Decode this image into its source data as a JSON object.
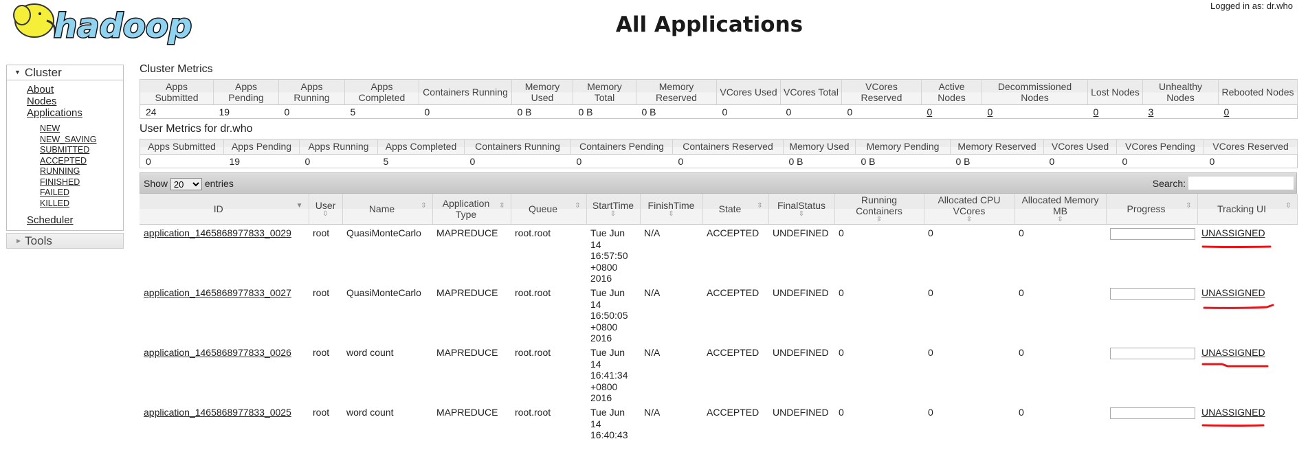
{
  "header": {
    "logo_text": "hadoop",
    "title": "All Applications",
    "logged_in": "Logged in as: dr.who"
  },
  "sidebar": {
    "cluster_label": "Cluster",
    "links": [
      "About",
      "Nodes",
      "Applications"
    ],
    "states": [
      "NEW",
      "NEW_SAVING",
      "SUBMITTED",
      "ACCEPTED",
      "RUNNING",
      "FINISHED",
      "FAILED",
      "KILLED"
    ],
    "scheduler": "Scheduler",
    "tools_label": "Tools"
  },
  "cluster_metrics": {
    "title": "Cluster Metrics",
    "headers": [
      "Apps Submitted",
      "Apps Pending",
      "Apps Running",
      "Apps Completed",
      "Containers Running",
      "Memory Used",
      "Memory Total",
      "Memory Reserved",
      "VCores Used",
      "VCores Total",
      "VCores Reserved",
      "Active Nodes",
      "Decommissioned Nodes",
      "Lost Nodes",
      "Unhealthy Nodes",
      "Rebooted Nodes"
    ],
    "values": [
      "24",
      "19",
      "0",
      "5",
      "0",
      "0 B",
      "0 B",
      "0 B",
      "0",
      "0",
      "0",
      "0",
      "0",
      "0",
      "3",
      "0"
    ],
    "linked": [
      false,
      false,
      false,
      false,
      false,
      false,
      false,
      false,
      false,
      false,
      false,
      true,
      true,
      true,
      true,
      true
    ]
  },
  "user_metrics": {
    "title": "User Metrics for dr.who",
    "headers": [
      "Apps Submitted",
      "Apps Pending",
      "Apps Running",
      "Apps Completed",
      "Containers Running",
      "Containers Pending",
      "Containers Reserved",
      "Memory Used",
      "Memory Pending",
      "Memory Reserved",
      "VCores Used",
      "VCores Pending",
      "VCores Reserved"
    ],
    "values": [
      "0",
      "19",
      "0",
      "5",
      "0",
      "0",
      "0",
      "0 B",
      "0 B",
      "0 B",
      "0",
      "0",
      "0"
    ]
  },
  "table_controls": {
    "show_label": "Show",
    "page_size": "20",
    "entries_label": "entries",
    "search_label": "Search:",
    "search_value": ""
  },
  "apps_table": {
    "headers": [
      "ID",
      "User",
      "Name",
      "Application Type",
      "Queue",
      "StartTime",
      "FinishTime",
      "State",
      "FinalStatus",
      "Running Containers",
      "Allocated CPU VCores",
      "Allocated Memory MB",
      "Progress",
      "Tracking UI"
    ],
    "rows": [
      {
        "id": "application_1465868977833_0029",
        "user": "root",
        "name": "QuasiMonteCarlo",
        "type": "MAPREDUCE",
        "queue": "root.root",
        "start": "Tue Jun 14 16:57:50 +0800 2016",
        "finish": "N/A",
        "state": "ACCEPTED",
        "final": "UNDEFINED",
        "containers": "0",
        "vcores": "0",
        "memory": "0",
        "progress": 0,
        "tracking": "UNASSIGNED"
      },
      {
        "id": "application_1465868977833_0027",
        "user": "root",
        "name": "QuasiMonteCarlo",
        "type": "MAPREDUCE",
        "queue": "root.root",
        "start": "Tue Jun 14 16:50:05 +0800 2016",
        "finish": "N/A",
        "state": "ACCEPTED",
        "final": "UNDEFINED",
        "containers": "0",
        "vcores": "0",
        "memory": "0",
        "progress": 0,
        "tracking": "UNASSIGNED"
      },
      {
        "id": "application_1465868977833_0026",
        "user": "root",
        "name": "word count",
        "type": "MAPREDUCE",
        "queue": "root.root",
        "start": "Tue Jun 14 16:41:34 +0800 2016",
        "finish": "N/A",
        "state": "ACCEPTED",
        "final": "UNDEFINED",
        "containers": "0",
        "vcores": "0",
        "memory": "0",
        "progress": 0,
        "tracking": "UNASSIGNED"
      },
      {
        "id": "application_1465868977833_0025",
        "user": "root",
        "name": "word count",
        "type": "MAPREDUCE",
        "queue": "root.root",
        "start": "Tue Jun 14 16:40:43",
        "finish": "N/A",
        "state": "ACCEPTED",
        "final": "UNDEFINED",
        "containers": "0",
        "vcores": "0",
        "memory": "0",
        "progress": 0,
        "tracking": "UNASSIGNED"
      }
    ]
  },
  "colors": {
    "annotation": "#e8141a",
    "logo_blue": "#8fd3f0",
    "logo_yellow": "#f5ef3a"
  }
}
